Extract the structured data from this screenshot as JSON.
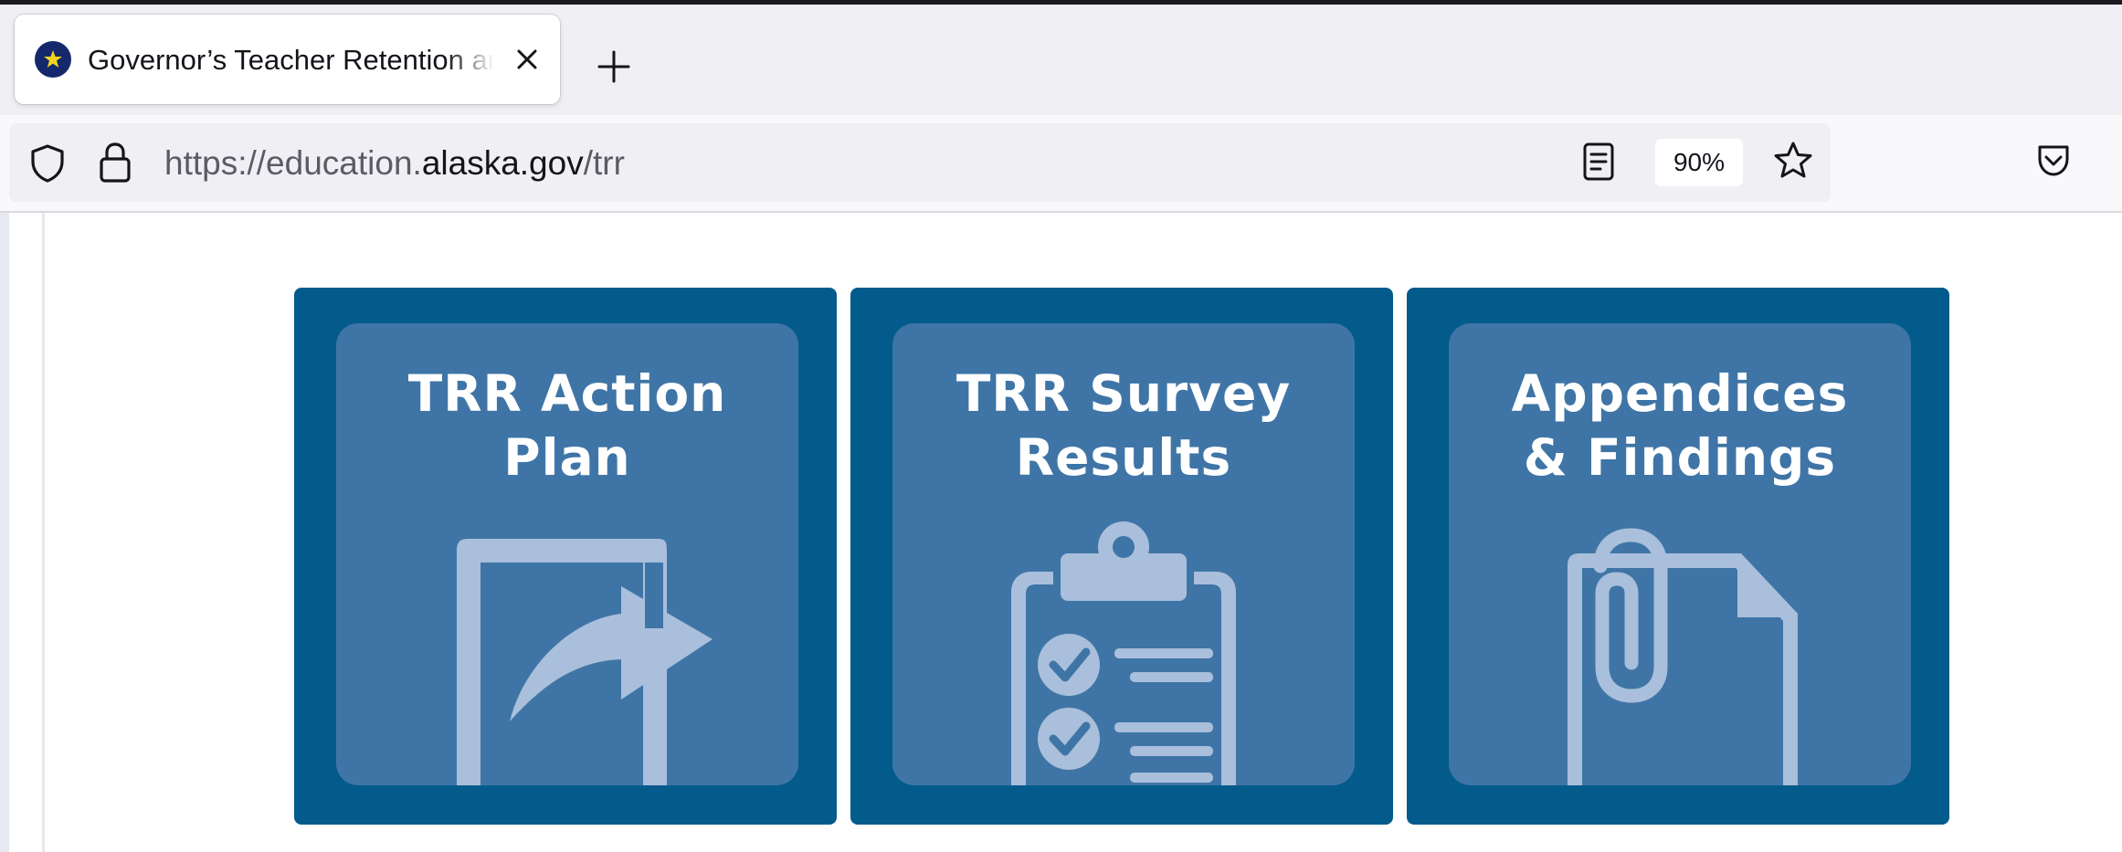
{
  "browser": {
    "tab": {
      "title": "Governor’s Teacher Retention and Recruitment"
    },
    "url": {
      "prefix": "https://education.",
      "domain": "alaska.gov",
      "path": "/trr"
    },
    "zoom": "90%"
  },
  "colors": {
    "card_bg": "#035b8c",
    "card_inner": "#3f75a6",
    "icon_fill": "#a9bfdb"
  },
  "cards": [
    {
      "line1": "TRR Action",
      "line2": "Plan",
      "icon": "share-arrow-icon"
    },
    {
      "line1": "TRR Survey",
      "line2": "Results",
      "icon": "clipboard-checklist-icon"
    },
    {
      "line1": "Appendices",
      "line2": "& Findings",
      "icon": "paperclip-document-icon"
    }
  ]
}
